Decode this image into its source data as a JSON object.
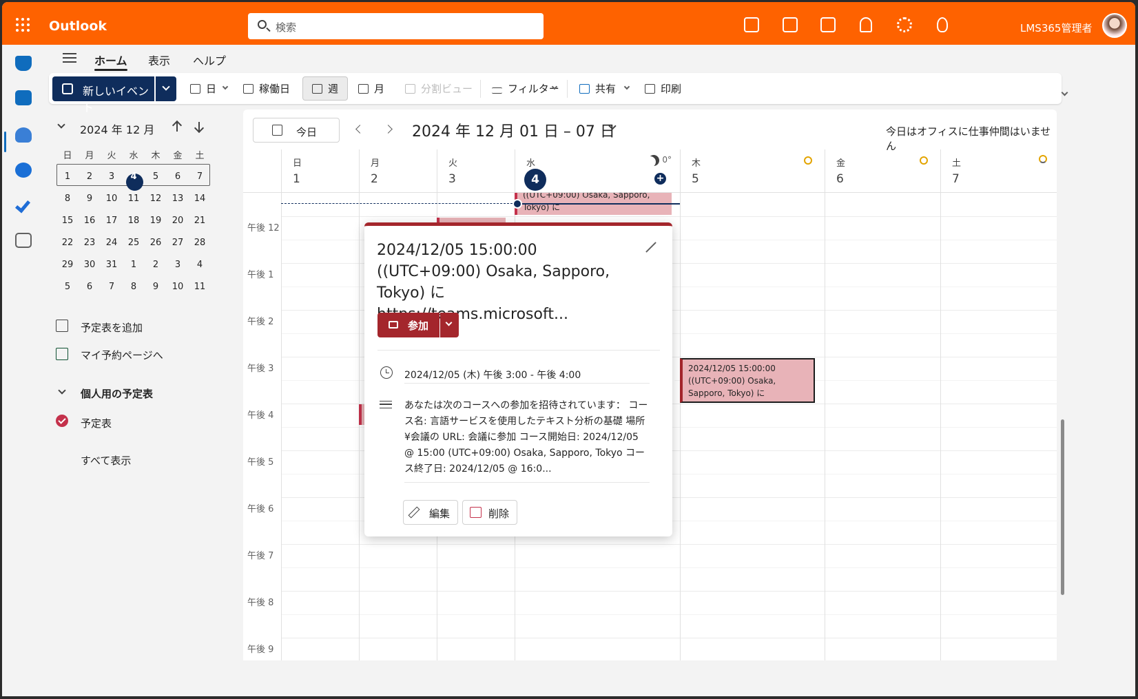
{
  "topbar": {
    "app_name": "Outlook",
    "search_placeholder": "検索",
    "user_name": "LMS365管理者",
    "color": "#fe6200"
  },
  "ribbon": {
    "tabs": [
      "ホーム",
      "表示",
      "ヘルプ"
    ],
    "new_event": "新しいイベント",
    "views": {
      "day": "日",
      "workweek": "稼働日",
      "week": "週",
      "month": "月",
      "split": "分割ビュー"
    },
    "filter": "フィルター",
    "share": "共有",
    "print": "印刷"
  },
  "mini_calendar": {
    "title": "2024 年 12 月",
    "weekdays": [
      "日",
      "月",
      "火",
      "水",
      "木",
      "金",
      "土"
    ],
    "weeks": [
      [
        "1",
        "2",
        "3",
        "4",
        "5",
        "6",
        "7"
      ],
      [
        "8",
        "9",
        "10",
        "11",
        "12",
        "13",
        "14"
      ],
      [
        "15",
        "16",
        "17",
        "18",
        "19",
        "20",
        "21"
      ],
      [
        "22",
        "23",
        "24",
        "25",
        "26",
        "27",
        "28"
      ],
      [
        "29",
        "30",
        "31",
        "1",
        "2",
        "3",
        "4"
      ],
      [
        "5",
        "6",
        "7",
        "8",
        "9",
        "10",
        "11"
      ]
    ],
    "today": "4"
  },
  "side_links": {
    "add_calendar": "予定表を追加",
    "booking": "マイ予約ページへ",
    "section_title": "個人用の予定表",
    "calendar_item": "予定表",
    "show_all": "すべて表示"
  },
  "calendar": {
    "today_button": "今日",
    "range": "2024 年 12 月 01 日 – 07 日",
    "status": "今日はオフィスに仕事仲間はいません",
    "days": [
      {
        "name": "日",
        "date": "1"
      },
      {
        "name": "月",
        "date": "2"
      },
      {
        "name": "火",
        "date": "3"
      },
      {
        "name": "水",
        "date": "4",
        "temp": "0°"
      },
      {
        "name": "木",
        "date": "5"
      },
      {
        "name": "金",
        "date": "6"
      },
      {
        "name": "土",
        "date": "7"
      }
    ],
    "hours": [
      "午後 12",
      "午後 1",
      "午後 2",
      "午後 3",
      "午後 4",
      "午後 5",
      "午後 6",
      "午後 7",
      "午後 8",
      "午後 9"
    ],
    "event_top_text": "((UTC+09:00) Osaka, Sapporo, Tokyo) に",
    "event_thu_text": "2024/12/05 15:00:00 ((UTC+09:00) Osaka, Sapporo, Tokyo) に",
    "event_color": "#e8b3b8"
  },
  "popup": {
    "title": "2024/12/05 15:00:00 ((UTC+09:00) Osaka, Sapporo, Tokyo) に https://teams.microsoft...",
    "join": "参加",
    "time": "2024/12/05 (木) 午後 3:00 - 午後 4:00",
    "description": "あなたは次のコースへの参加を招待されています： コース名: 言語サービスを使用したテキスト分析の基礎 場所 ¥会議の URL: 会議に参加 コース開始日: 2024/12/05 @ 15:00 (UTC+09:00) Osaka, Sapporo, Tokyo コース終了日: 2024/12/05 @ 16:0...",
    "edit": "編集",
    "delete": "削除",
    "accent": "#a4262c"
  }
}
